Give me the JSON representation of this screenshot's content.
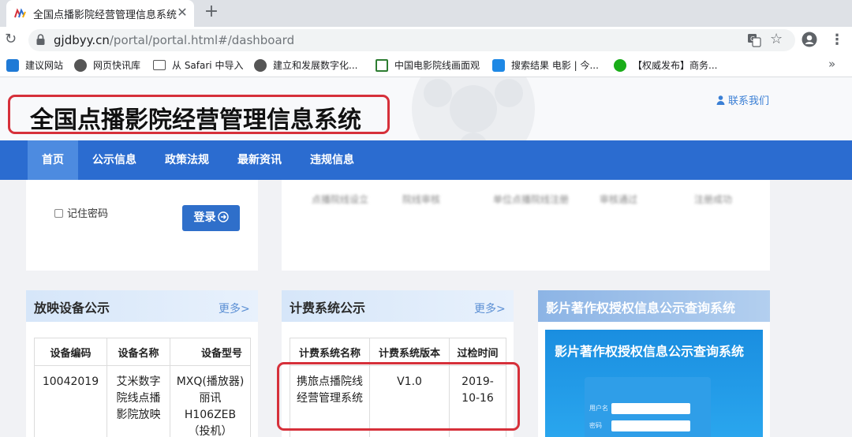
{
  "browser": {
    "tab_title": "全国点播影院经营管理信息系统",
    "tab_close": "✕",
    "new_tab": "+",
    "url_host": "gjdbyy.cn",
    "url_path": "/portal/portal.html#/dashboard",
    "bookmarks": [
      {
        "label": "建议网站",
        "color": "#1f7ad6"
      },
      {
        "label": "网页快讯库",
        "color": "#555555"
      },
      {
        "label": "从 Safari 中导入",
        "color": "#555555"
      },
      {
        "label": "建立和发展数字化...",
        "color": "#555555"
      },
      {
        "label": "中国电影院线画面观",
        "color": "#2e7d32"
      },
      {
        "label": "搜索结果 电影 | 今...",
        "color": "#1e88e5"
      },
      {
        "label": "【权威发布】商务...",
        "color": "#1aad19"
      }
    ],
    "bookmarks_more": "»"
  },
  "header": {
    "title": "全国点播影院经营管理信息系统",
    "contact": "联系我们"
  },
  "nav": {
    "items": [
      "首页",
      "公示信息",
      "政策法规",
      "最新资讯",
      "违规信息"
    ]
  },
  "login": {
    "remember": "记住密码",
    "button": "登录"
  },
  "notice_tabs": [
    "点播院线设立",
    "院线审核",
    "单位点播院线注册",
    "审核通过",
    "注册成功"
  ],
  "equipment": {
    "title": "放映设备公示",
    "more": "更多>",
    "headers": [
      "设备编码",
      "设备名称",
      "设备型号"
    ],
    "row": [
      "10042019",
      "艾米数字院线点播影院放映",
      "MXQ(播放器) 丽讯H106ZEB（投机）"
    ]
  },
  "billing": {
    "title": "计费系统公示",
    "more": "更多>",
    "headers": [
      "计费系统名称",
      "计费系统版本",
      "过检时间"
    ],
    "row": [
      "携旅点播院线经营管理系统",
      "V1.0",
      "2019-10-16"
    ]
  },
  "copyright": {
    "title": "影片著作权授权信息公示查询系统",
    "promo_title": "影片著作权授权信息公示查询系统",
    "field_user": "用户名",
    "field_pass": "密码"
  }
}
